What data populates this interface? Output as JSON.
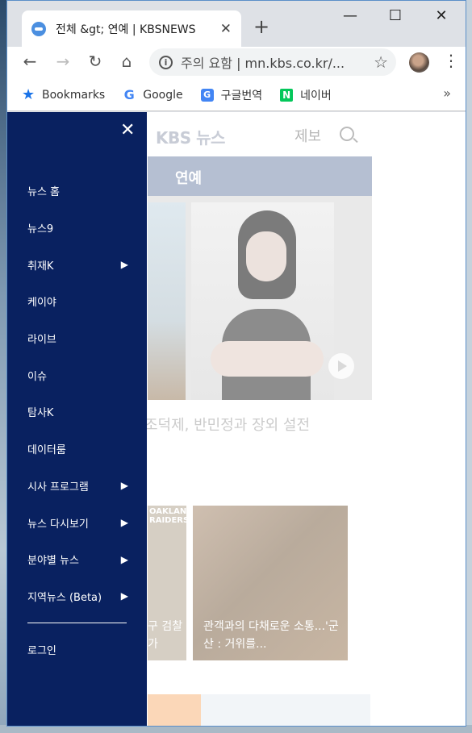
{
  "browser": {
    "tab_title": "전체 &gt; 연예 | KBSNEWS",
    "tab_close": "✕",
    "new_tab": "+",
    "minimize": "—",
    "maximize": "☐",
    "close": "✕",
    "omnibox_security": "주의 요함",
    "omnibox_separator": "|",
    "omnibox_url": "mn.kbs.co.kr/...",
    "bookmarks": [
      "Bookmarks",
      "Google",
      "구글번역",
      "네이버"
    ],
    "bookmarks_more": "»"
  },
  "site": {
    "logo": "KBS 뉴스",
    "report_label": "제보",
    "section_title": "연예",
    "hero_caption": "조덕제, 반민정과 장외 설전",
    "thumb_left_caption": "구 검찰\n가",
    "thumb_left_badge": "OAKLAND\nRAIDERS",
    "thumb_caption": "관객과의 다채로운 소통...'군산 : 거위를..."
  },
  "drawer": {
    "close": "✕",
    "items": [
      {
        "label": "뉴스 홈",
        "arrow": ""
      },
      {
        "label": "뉴스9",
        "arrow": ""
      },
      {
        "label": "취재K",
        "arrow": "▶"
      },
      {
        "label": "케이야",
        "arrow": ""
      },
      {
        "label": "라이브",
        "arrow": ""
      },
      {
        "label": "이슈",
        "arrow": ""
      },
      {
        "label": "탐사K",
        "arrow": ""
      },
      {
        "label": "데이터룸",
        "arrow": ""
      },
      {
        "label": "시사 프로그램",
        "arrow": "▶"
      },
      {
        "label": "뉴스 다시보기",
        "arrow": "▶"
      },
      {
        "label": "분야별 뉴스",
        "arrow": "▶"
      },
      {
        "label": "지역뉴스 (Beta)",
        "arrow": "▶"
      }
    ],
    "login": "로그인"
  },
  "colors": {
    "drawer_bg": "#092160",
    "section_bar": "#b5bfd2"
  },
  "icons": [
    "search-icon",
    "star-icon",
    "info-icon",
    "back-icon",
    "forward-icon",
    "reload-icon",
    "home-icon",
    "menu-icon",
    "close-icon",
    "play-icon",
    "chevron-right-icon"
  ]
}
